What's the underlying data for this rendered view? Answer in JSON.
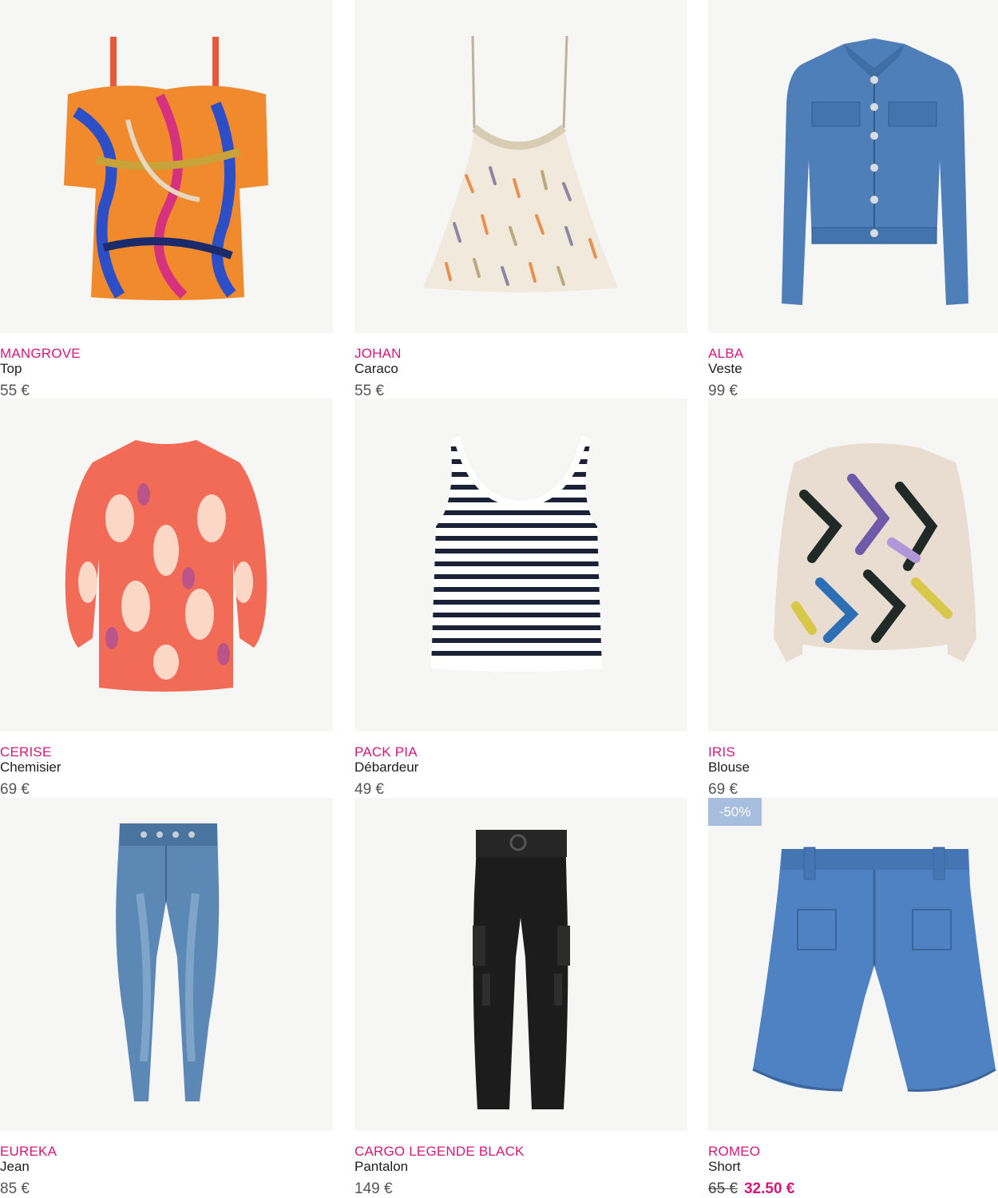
{
  "products": [
    {
      "brand": "MANGROVE",
      "type": "Top",
      "price": "55 €",
      "image_icon": "printed-off-shoulder-top"
    },
    {
      "brand": "JOHAN",
      "type": "Caraco",
      "price": "55 €",
      "image_icon": "patterned-camisole"
    },
    {
      "brand": "ALBA",
      "type": "Veste",
      "price": "99 €",
      "image_icon": "denim-jacket"
    },
    {
      "brand": "CERISE",
      "type": "Chemisier",
      "price": "69 €",
      "image_icon": "ikat-blouse"
    },
    {
      "brand": "PACK PIA",
      "type": "Débardeur",
      "price": "49 €",
      "image_icon": "striped-tank-top"
    },
    {
      "brand": "IRIS",
      "type": "Blouse",
      "price": "69 €",
      "image_icon": "patterned-blouse"
    },
    {
      "brand": "EUREKA",
      "type": "Jean",
      "price": "85 €",
      "image_icon": "skinny-jeans"
    },
    {
      "brand": "CARGO LEGENDE BLACK",
      "type": "Pantalon",
      "price": "149 €",
      "image_icon": "black-cargo-pants"
    },
    {
      "brand": "ROMEO",
      "type": "Short",
      "old_price": "65 €",
      "new_price": "32.50 €",
      "badge": "-50%",
      "image_icon": "denim-shorts"
    }
  ],
  "colors": {
    "brand": "#d4187a",
    "badge": "#a8bedf",
    "image_bg": "#f6f6f5"
  }
}
